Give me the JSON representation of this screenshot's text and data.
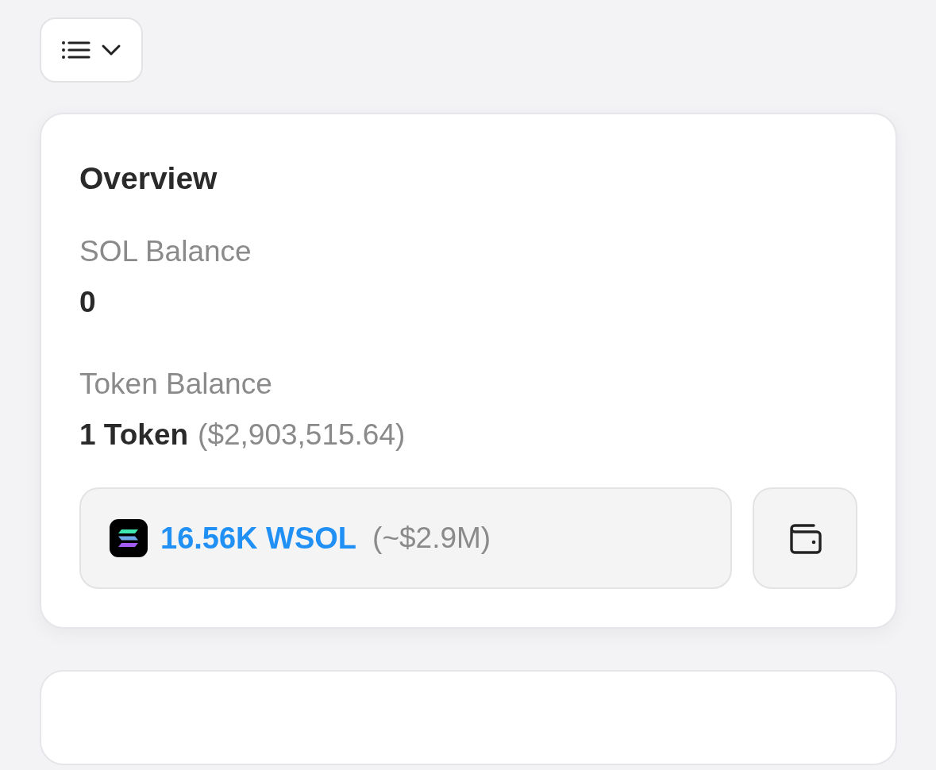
{
  "overview": {
    "title": "Overview",
    "sol_balance": {
      "label": "SOL Balance",
      "value": "0"
    },
    "token_balance": {
      "label": "Token Balance",
      "value": "1 Token",
      "usd": "($2,903,515.64)"
    },
    "token_holding": {
      "amount": "16.56K WSOL",
      "usd": "(~$2.9M)"
    }
  }
}
